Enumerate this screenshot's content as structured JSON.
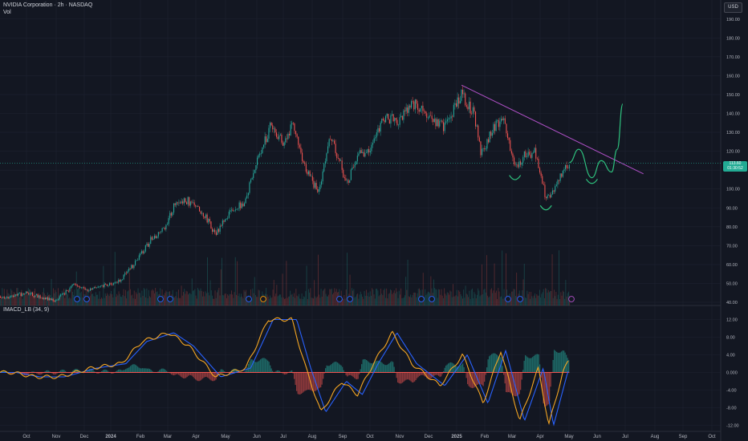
{
  "header": {
    "title": "NVIDIA Corporation · 2h · NASDAQ",
    "volume_label": "Vol",
    "currency_button": "USD",
    "indicator_label": "IMACD_LB (34, 9)",
    "last_price": "113.60",
    "countdown": "01:30:52"
  },
  "colors": {
    "background": "#131722",
    "grid": "#1e2230",
    "up": "#26a69a",
    "down": "#ef5350",
    "trendline": "#b150c8",
    "projection": "#2ec27e",
    "macd_line": "#f5a623",
    "signal_line": "#2962ff",
    "price_tag": "#22ab94"
  },
  "chart_data": [
    {
      "type": "candlestick",
      "y_axis_ticks": [
        "190.00",
        "180.00",
        "170.00",
        "160.00",
        "150.00",
        "140.00",
        "130.00",
        "120.00",
        "110.00",
        "100.00",
        "90.00",
        "80.00",
        "70.00",
        "60.00",
        "50.00",
        "40.00"
      ],
      "ylim": [
        40,
        195
      ],
      "x_axis_ticks": [
        "Oct",
        "Nov",
        "Dec",
        "2024",
        "Feb",
        "Mar",
        "Apr",
        "May",
        "Jun",
        "Jul",
        "Aug",
        "Sep",
        "Oct",
        "Nov",
        "Dec",
        "2025",
        "Feb",
        "Mar",
        "Apr",
        "May",
        "Jun",
        "Jul",
        "Aug",
        "Sep",
        "Oct"
      ],
      "price_path": [
        {
          "date": "2023-09-15",
          "close": 43
        },
        {
          "date": "2023-10-01",
          "close": 45
        },
        {
          "date": "2023-10-20",
          "close": 42
        },
        {
          "date": "2023-11-01",
          "close": 41
        },
        {
          "date": "2023-11-20",
          "close": 49
        },
        {
          "date": "2023-12-05",
          "close": 46
        },
        {
          "date": "2023-12-20",
          "close": 49
        },
        {
          "date": "2024-01-05",
          "close": 50
        },
        {
          "date": "2024-01-25",
          "close": 61
        },
        {
          "date": "2024-02-10",
          "close": 73
        },
        {
          "date": "2024-02-25",
          "close": 80
        },
        {
          "date": "2024-03-08",
          "close": 93
        },
        {
          "date": "2024-03-20",
          "close": 94
        },
        {
          "date": "2024-04-05",
          "close": 88
        },
        {
          "date": "2024-04-19",
          "close": 76
        },
        {
          "date": "2024-05-01",
          "close": 86
        },
        {
          "date": "2024-05-20",
          "close": 93
        },
        {
          "date": "2024-06-01",
          "close": 112
        },
        {
          "date": "2024-06-18",
          "close": 135
        },
        {
          "date": "2024-06-30",
          "close": 124
        },
        {
          "date": "2024-07-10",
          "close": 134
        },
        {
          "date": "2024-07-25",
          "close": 110
        },
        {
          "date": "2024-08-07",
          "close": 98
        },
        {
          "date": "2024-08-20",
          "close": 129
        },
        {
          "date": "2024-09-06",
          "close": 103
        },
        {
          "date": "2024-09-20",
          "close": 118
        },
        {
          "date": "2024-10-01",
          "close": 122
        },
        {
          "date": "2024-10-15",
          "close": 138
        },
        {
          "date": "2024-11-01",
          "close": 136
        },
        {
          "date": "2024-11-15",
          "close": 146
        },
        {
          "date": "2024-12-01",
          "close": 138
        },
        {
          "date": "2024-12-20",
          "close": 133
        },
        {
          "date": "2025-01-07",
          "close": 150
        },
        {
          "date": "2025-01-20",
          "close": 140
        },
        {
          "date": "2025-01-27",
          "close": 119
        },
        {
          "date": "2025-02-10",
          "close": 132
        },
        {
          "date": "2025-02-20",
          "close": 139
        },
        {
          "date": "2025-03-05",
          "close": 111
        },
        {
          "date": "2025-03-15",
          "close": 118
        },
        {
          "date": "2025-03-26",
          "close": 120
        },
        {
          "date": "2025-04-07",
          "close": 94
        },
        {
          "date": "2025-04-18",
          "close": 102
        },
        {
          "date": "2025-04-25",
          "close": 110
        },
        {
          "date": "2025-05-02",
          "close": 113.6
        }
      ],
      "trendline": [
        {
          "date": "2025-01-07",
          "price": 155
        },
        {
          "date": "2025-07-20",
          "price": 108
        }
      ],
      "projection": [
        {
          "date": "2025-05-02",
          "price": 114
        },
        {
          "date": "2025-05-12",
          "price": 121
        },
        {
          "date": "2025-05-26",
          "price": 106
        },
        {
          "date": "2025-06-05",
          "price": 115
        },
        {
          "date": "2025-06-16",
          "price": 109
        },
        {
          "date": "2025-06-22",
          "price": 121
        },
        {
          "date": "2025-06-28",
          "price": 145
        }
      ]
    },
    {
      "type": "area",
      "name": "IMACD_LB (34, 9)",
      "y_axis_ticks": [
        "12.00",
        "8.00",
        "4.00",
        "0.000",
        "-4.00",
        "-8.00",
        "-12.00"
      ],
      "ylim": [
        -14,
        14
      ],
      "macd_path": [
        {
          "date": "2023-09-15",
          "value": 0
        },
        {
          "date": "2023-10-10",
          "value": -1
        },
        {
          "date": "2023-11-05",
          "value": -1
        },
        {
          "date": "2023-12-10",
          "value": 1
        },
        {
          "date": "2024-01-10",
          "value": 2
        },
        {
          "date": "2024-02-01",
          "value": 7
        },
        {
          "date": "2024-03-01",
          "value": 9
        },
        {
          "date": "2024-03-22",
          "value": 6
        },
        {
          "date": "2024-04-20",
          "value": -1
        },
        {
          "date": "2024-05-22",
          "value": 1
        },
        {
          "date": "2024-06-15",
          "value": 12
        },
        {
          "date": "2024-07-10",
          "value": 12
        },
        {
          "date": "2024-07-25",
          "value": 1
        },
        {
          "date": "2024-08-10",
          "value": -9
        },
        {
          "date": "2024-09-01",
          "value": -2
        },
        {
          "date": "2024-09-18",
          "value": -5
        },
        {
          "date": "2024-10-05",
          "value": 2
        },
        {
          "date": "2024-10-25",
          "value": 9
        },
        {
          "date": "2024-11-15",
          "value": 2
        },
        {
          "date": "2024-12-15",
          "value": -3
        },
        {
          "date": "2025-01-08",
          "value": 4
        },
        {
          "date": "2025-01-30",
          "value": -7
        },
        {
          "date": "2025-02-18",
          "value": 5
        },
        {
          "date": "2025-03-10",
          "value": -11
        },
        {
          "date": "2025-03-30",
          "value": 1
        },
        {
          "date": "2025-04-10",
          "value": -12
        },
        {
          "date": "2025-04-25",
          "value": 0
        },
        {
          "date": "2025-05-02",
          "value": 3
        }
      ]
    }
  ]
}
